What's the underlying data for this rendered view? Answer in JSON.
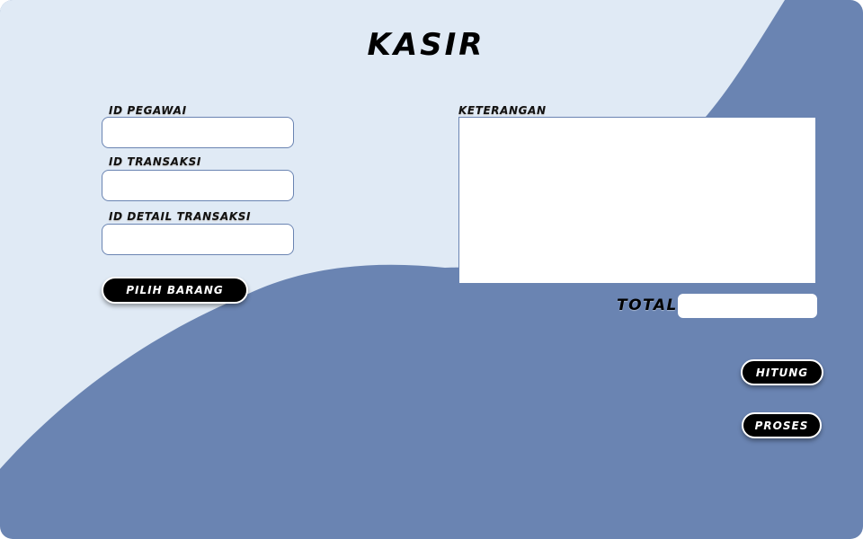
{
  "app": {
    "title": "KASIR"
  },
  "colors": {
    "light_panel": "#e0eaf5",
    "accent_blue": "#6a84b2",
    "button_bg": "#000000",
    "button_text": "#ffffff"
  },
  "form": {
    "id_pegawai": {
      "label": "ID PEGAWAI",
      "value": ""
    },
    "id_transaksi": {
      "label": "ID TRANSAKSI",
      "value": ""
    },
    "id_detail_transaksi": {
      "label": "ID DETAIL TRANSAKSI",
      "value": ""
    },
    "keterangan": {
      "label": "KETERANGAN",
      "value": ""
    },
    "total": {
      "label": "TOTAL",
      "value": ""
    }
  },
  "buttons": {
    "pilih_barang": "PILIH BARANG",
    "hitung": "HITUNG",
    "proses": "PROSES"
  }
}
